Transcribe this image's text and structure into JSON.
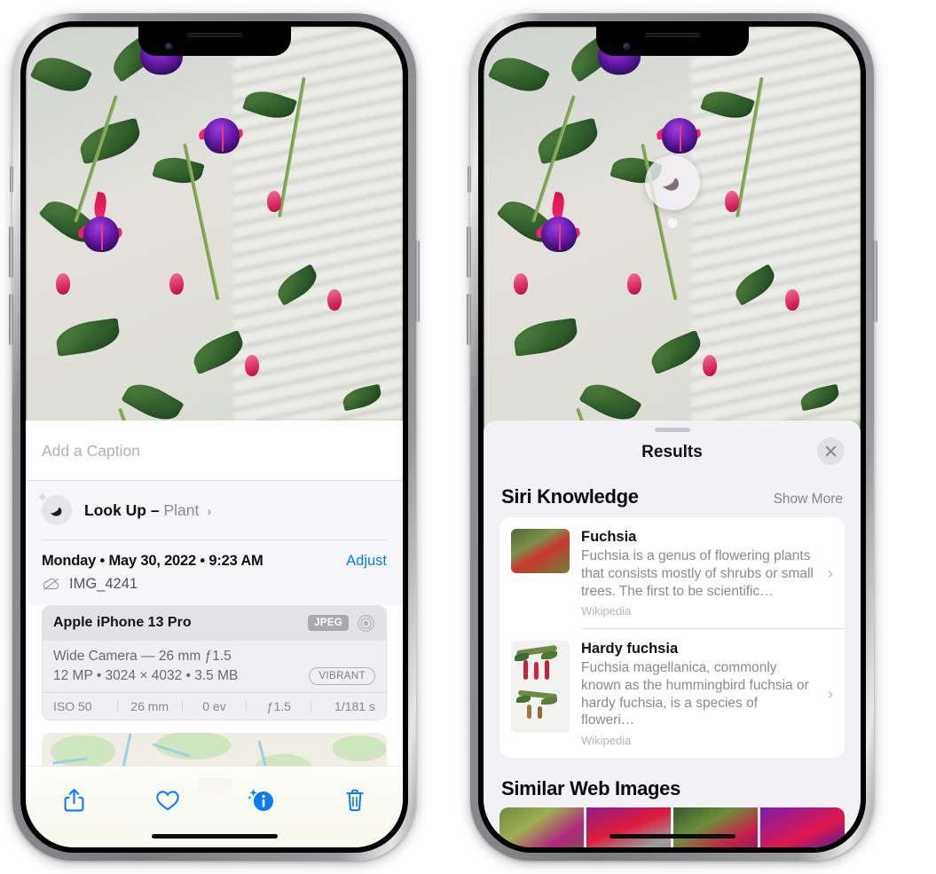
{
  "left_phone": {
    "caption": {
      "placeholder": "Add a Caption",
      "value": ""
    },
    "lookup": {
      "label": "Look Up –",
      "subject": "Plant",
      "chevron": "›",
      "icon": "leaf-icon"
    },
    "meta": {
      "date": "Monday • May 30, 2022 • 9:23 AM",
      "adjust_label": "Adjust",
      "filename": "IMG_4241",
      "cloud_icon": "icloud-slash-icon"
    },
    "camera": {
      "model": "Apple iPhone 13 Pro",
      "format_badge": "JPEG",
      "aperture_icon": "aperture-icon",
      "lens": "Wide Camera — 26 mm ƒ1.5",
      "specs": "12 MP • 3024 × 4032 • 3.5 MB",
      "style_badge": "VIBRANT",
      "exif": [
        "ISO 50",
        "26 mm",
        "0 ev",
        "ƒ1.5",
        "1/181 s"
      ]
    },
    "toolbar": [
      {
        "name": "share-icon",
        "label": "Share"
      },
      {
        "name": "heart-icon",
        "label": "Favorite"
      },
      {
        "name": "info-sparkle-icon",
        "label": "Info"
      },
      {
        "name": "trash-icon",
        "label": "Delete"
      }
    ]
  },
  "right_phone": {
    "visual_lookup_badge": {
      "icon": "leaf-icon"
    },
    "results": {
      "title": "Results",
      "close_icon": "close-icon",
      "siri_knowledge": {
        "heading": "Siri Knowledge",
        "show_more": "Show More",
        "items": [
          {
            "title": "Fuchsia",
            "description": "Fuchsia is a genus of flowering plants that consists mostly of shrubs or small trees. The first to be scientific…",
            "source": "Wikipedia",
            "chevron": "›"
          },
          {
            "title": "Hardy fuchsia",
            "description": "Fuchsia magellanica, commonly known as the hummingbird fuchsia or hardy fuchsia, is a species of floweri…",
            "source": "Wikipedia",
            "chevron": "›"
          }
        ]
      },
      "similar_web_images": {
        "heading": "Similar Web Images",
        "items": [
          "fuchsia-thumb-1",
          "fuchsia-thumb-2",
          "fuchsia-thumb-3",
          "fuchsia-thumb-4"
        ]
      }
    }
  },
  "colors": {
    "accent_blue": "#087aff",
    "sheet_bg": "#f2f1f6",
    "card_bg": "#ffffff"
  }
}
